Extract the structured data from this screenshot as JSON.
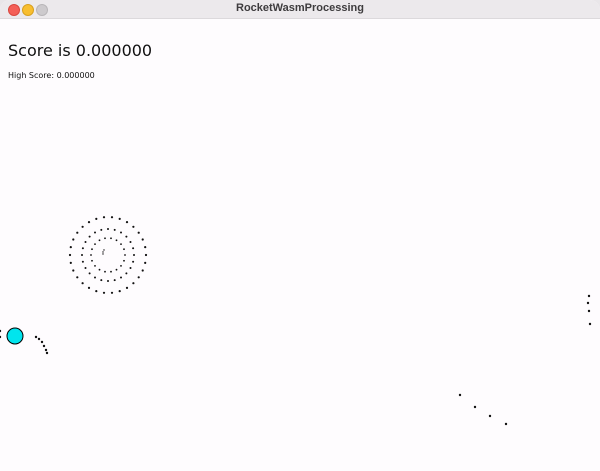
{
  "window": {
    "title": "RocketWasmProcessing"
  },
  "hud": {
    "score_text": "Score is 0.000000",
    "high_score_text": "High Score: 0.000000"
  },
  "colors": {
    "rocket_fill": "#00e5ee",
    "dots": "#111111"
  }
}
